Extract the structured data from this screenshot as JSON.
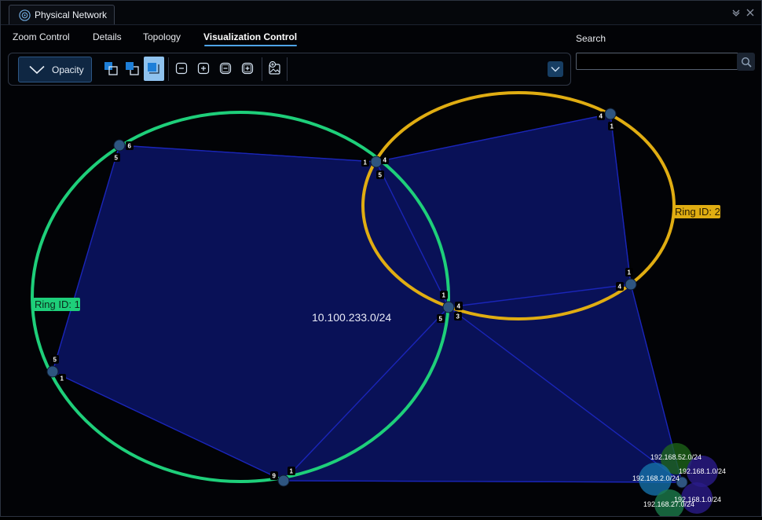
{
  "window": {
    "title": "Physical Network"
  },
  "tabs": [
    {
      "label": "Zoom Control"
    },
    {
      "label": "Details"
    },
    {
      "label": "Topology"
    },
    {
      "label": "Visualization Control",
      "active": true
    }
  ],
  "toolbar": {
    "opacity_label": "Opacity",
    "tools": [
      "bring-to-front-icon",
      "send-to-back-icon",
      "fit-selection-icon",
      "zoom-out-icon",
      "zoom-in-icon",
      "collapse-all-icon",
      "expand-all-icon",
      "export-image-icon"
    ],
    "selected_tool": "fit-selection-icon"
  },
  "search": {
    "label": "Search",
    "value": "",
    "placeholder": ""
  },
  "topology": {
    "subnet_label": "10.100.233.0/24",
    "rings": [
      {
        "label": "Ring ID: 1",
        "color": "#1ecf7a"
      },
      {
        "label": "Ring ID: 2",
        "color": "#e0ad12"
      }
    ],
    "port_labels": [
      "6",
      "5",
      "1",
      "4",
      "5",
      "4",
      "1",
      "1",
      "4",
      "1",
      "4",
      "3",
      "5",
      "5",
      "1",
      "9",
      "1"
    ],
    "cluster_labels": [
      "192.168.52.0/24",
      "192.168.1.0/24",
      "192.168.2.0/24",
      "192.168.1.0/24",
      "192.168.27.0/24"
    ],
    "colors": {
      "accent": "#4ea3e6",
      "region_fill": "#0a1466",
      "link": "#1a25b8",
      "node": "#2e5580",
      "background": "#000000"
    }
  }
}
